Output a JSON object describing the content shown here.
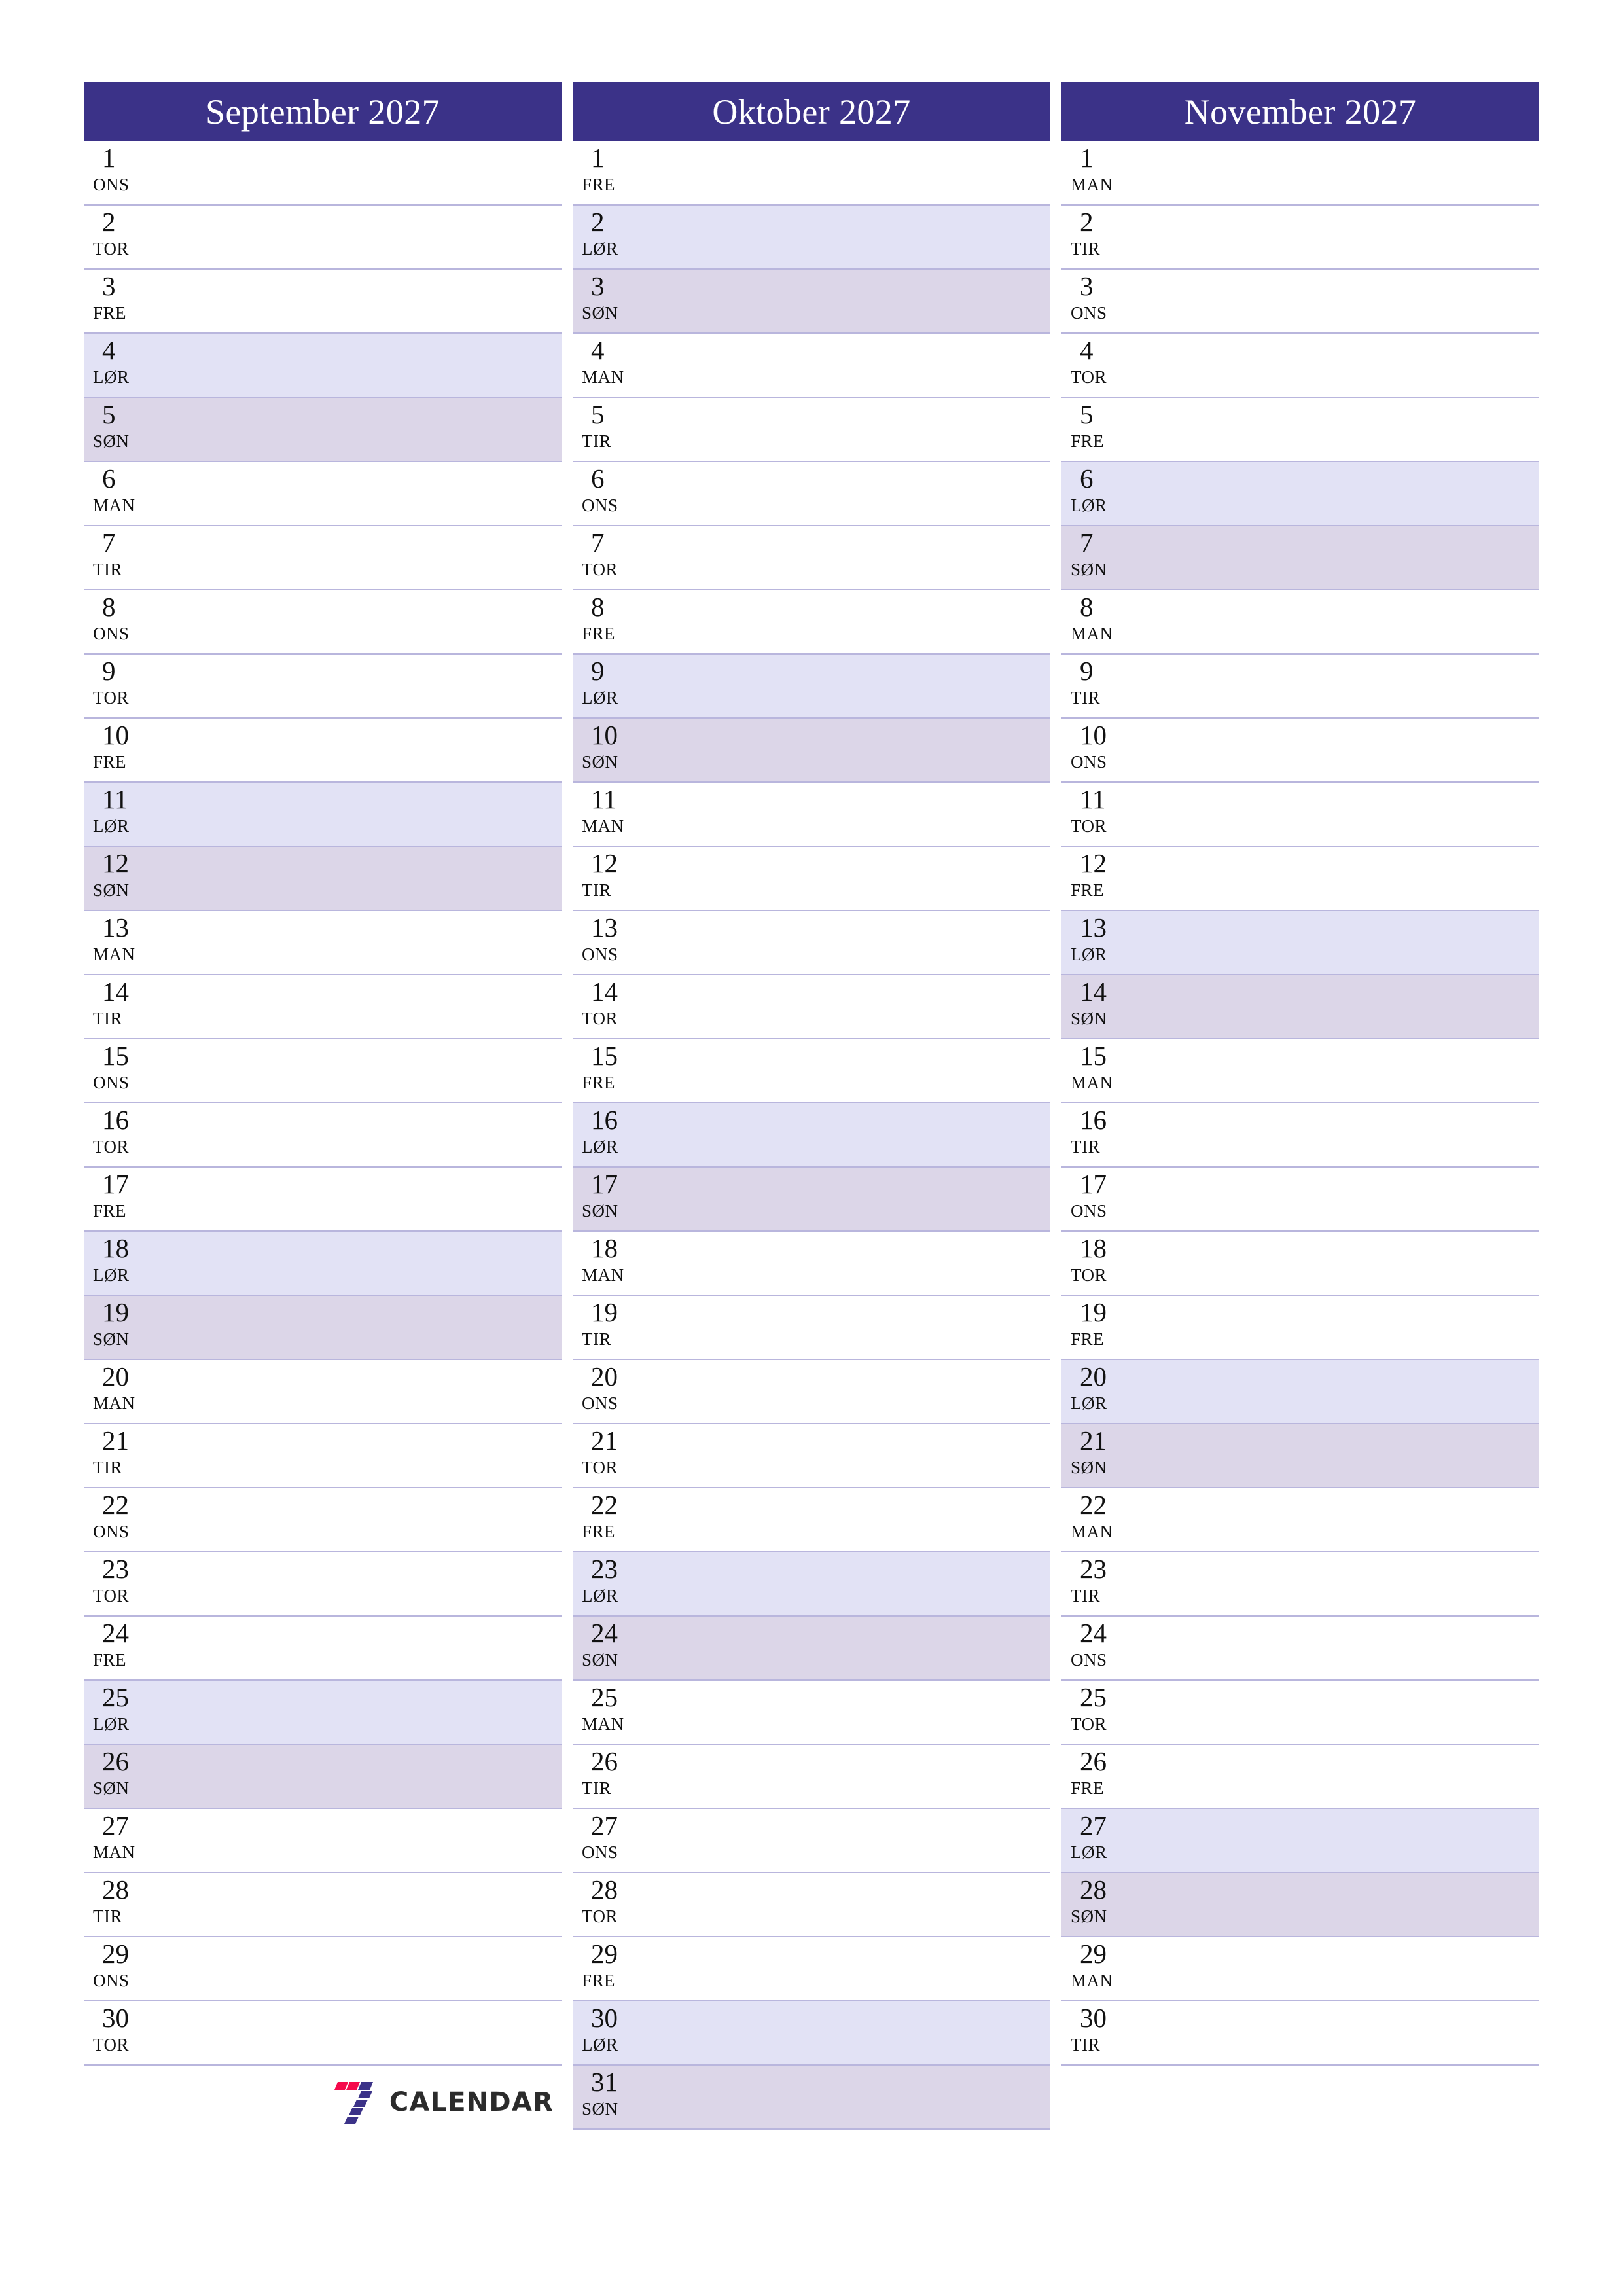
{
  "document": {
    "type": "three-month-planner",
    "year": "2027",
    "locale_language": "Norwegian",
    "page_background": "#ffffff"
  },
  "colors": {
    "header_bg": "#3B3288",
    "header_text": "#ffffff",
    "saturday_bg": "#e2e2f5",
    "sunday_bg": "#dcd6e8",
    "row_divider": "#b9b6dd",
    "day_text": "#111111",
    "logo_red": "#F5094B",
    "logo_navy": "#3B3288",
    "logo_word": "#2b2b2b"
  },
  "logo": {
    "mark_name": "seven-logo-mark",
    "word": "CALENDAR"
  },
  "months": [
    {
      "title": "September 2027",
      "days": [
        {
          "num": "1",
          "wd": "ONS",
          "kind": "weekday"
        },
        {
          "num": "2",
          "wd": "TOR",
          "kind": "weekday"
        },
        {
          "num": "3",
          "wd": "FRE",
          "kind": "weekday"
        },
        {
          "num": "4",
          "wd": "LØR",
          "kind": "sat"
        },
        {
          "num": "5",
          "wd": "SØN",
          "kind": "sun"
        },
        {
          "num": "6",
          "wd": "MAN",
          "kind": "weekday"
        },
        {
          "num": "7",
          "wd": "TIR",
          "kind": "weekday"
        },
        {
          "num": "8",
          "wd": "ONS",
          "kind": "weekday"
        },
        {
          "num": "9",
          "wd": "TOR",
          "kind": "weekday"
        },
        {
          "num": "10",
          "wd": "FRE",
          "kind": "weekday"
        },
        {
          "num": "11",
          "wd": "LØR",
          "kind": "sat"
        },
        {
          "num": "12",
          "wd": "SØN",
          "kind": "sun"
        },
        {
          "num": "13",
          "wd": "MAN",
          "kind": "weekday"
        },
        {
          "num": "14",
          "wd": "TIR",
          "kind": "weekday"
        },
        {
          "num": "15",
          "wd": "ONS",
          "kind": "weekday"
        },
        {
          "num": "16",
          "wd": "TOR",
          "kind": "weekday"
        },
        {
          "num": "17",
          "wd": "FRE",
          "kind": "weekday"
        },
        {
          "num": "18",
          "wd": "LØR",
          "kind": "sat"
        },
        {
          "num": "19",
          "wd": "SØN",
          "kind": "sun"
        },
        {
          "num": "20",
          "wd": "MAN",
          "kind": "weekday"
        },
        {
          "num": "21",
          "wd": "TIR",
          "kind": "weekday"
        },
        {
          "num": "22",
          "wd": "ONS",
          "kind": "weekday"
        },
        {
          "num": "23",
          "wd": "TOR",
          "kind": "weekday"
        },
        {
          "num": "24",
          "wd": "FRE",
          "kind": "weekday"
        },
        {
          "num": "25",
          "wd": "LØR",
          "kind": "sat"
        },
        {
          "num": "26",
          "wd": "SØN",
          "kind": "sun"
        },
        {
          "num": "27",
          "wd": "MAN",
          "kind": "weekday"
        },
        {
          "num": "28",
          "wd": "TIR",
          "kind": "weekday"
        },
        {
          "num": "29",
          "wd": "ONS",
          "kind": "weekday"
        },
        {
          "num": "30",
          "wd": "TOR",
          "kind": "weekday"
        }
      ],
      "has_logo": true
    },
    {
      "title": "Oktober 2027",
      "days": [
        {
          "num": "1",
          "wd": "FRE",
          "kind": "weekday"
        },
        {
          "num": "2",
          "wd": "LØR",
          "kind": "sat"
        },
        {
          "num": "3",
          "wd": "SØN",
          "kind": "sun"
        },
        {
          "num": "4",
          "wd": "MAN",
          "kind": "weekday"
        },
        {
          "num": "5",
          "wd": "TIR",
          "kind": "weekday"
        },
        {
          "num": "6",
          "wd": "ONS",
          "kind": "weekday"
        },
        {
          "num": "7",
          "wd": "TOR",
          "kind": "weekday"
        },
        {
          "num": "8",
          "wd": "FRE",
          "kind": "weekday"
        },
        {
          "num": "9",
          "wd": "LØR",
          "kind": "sat"
        },
        {
          "num": "10",
          "wd": "SØN",
          "kind": "sun"
        },
        {
          "num": "11",
          "wd": "MAN",
          "kind": "weekday"
        },
        {
          "num": "12",
          "wd": "TIR",
          "kind": "weekday"
        },
        {
          "num": "13",
          "wd": "ONS",
          "kind": "weekday"
        },
        {
          "num": "14",
          "wd": "TOR",
          "kind": "weekday"
        },
        {
          "num": "15",
          "wd": "FRE",
          "kind": "weekday"
        },
        {
          "num": "16",
          "wd": "LØR",
          "kind": "sat"
        },
        {
          "num": "17",
          "wd": "SØN",
          "kind": "sun"
        },
        {
          "num": "18",
          "wd": "MAN",
          "kind": "weekday"
        },
        {
          "num": "19",
          "wd": "TIR",
          "kind": "weekday"
        },
        {
          "num": "20",
          "wd": "ONS",
          "kind": "weekday"
        },
        {
          "num": "21",
          "wd": "TOR",
          "kind": "weekday"
        },
        {
          "num": "22",
          "wd": "FRE",
          "kind": "weekday"
        },
        {
          "num": "23",
          "wd": "LØR",
          "kind": "sat"
        },
        {
          "num": "24",
          "wd": "SØN",
          "kind": "sun"
        },
        {
          "num": "25",
          "wd": "MAN",
          "kind": "weekday"
        },
        {
          "num": "26",
          "wd": "TIR",
          "kind": "weekday"
        },
        {
          "num": "27",
          "wd": "ONS",
          "kind": "weekday"
        },
        {
          "num": "28",
          "wd": "TOR",
          "kind": "weekday"
        },
        {
          "num": "29",
          "wd": "FRE",
          "kind": "weekday"
        },
        {
          "num": "30",
          "wd": "LØR",
          "kind": "sat"
        },
        {
          "num": "31",
          "wd": "SØN",
          "kind": "sun"
        }
      ],
      "has_logo": false
    },
    {
      "title": "November 2027",
      "days": [
        {
          "num": "1",
          "wd": "MAN",
          "kind": "weekday"
        },
        {
          "num": "2",
          "wd": "TIR",
          "kind": "weekday"
        },
        {
          "num": "3",
          "wd": "ONS",
          "kind": "weekday"
        },
        {
          "num": "4",
          "wd": "TOR",
          "kind": "weekday"
        },
        {
          "num": "5",
          "wd": "FRE",
          "kind": "weekday"
        },
        {
          "num": "6",
          "wd": "LØR",
          "kind": "sat"
        },
        {
          "num": "7",
          "wd": "SØN",
          "kind": "sun"
        },
        {
          "num": "8",
          "wd": "MAN",
          "kind": "weekday"
        },
        {
          "num": "9",
          "wd": "TIR",
          "kind": "weekday"
        },
        {
          "num": "10",
          "wd": "ONS",
          "kind": "weekday"
        },
        {
          "num": "11",
          "wd": "TOR",
          "kind": "weekday"
        },
        {
          "num": "12",
          "wd": "FRE",
          "kind": "weekday"
        },
        {
          "num": "13",
          "wd": "LØR",
          "kind": "sat"
        },
        {
          "num": "14",
          "wd": "SØN",
          "kind": "sun"
        },
        {
          "num": "15",
          "wd": "MAN",
          "kind": "weekday"
        },
        {
          "num": "16",
          "wd": "TIR",
          "kind": "weekday"
        },
        {
          "num": "17",
          "wd": "ONS",
          "kind": "weekday"
        },
        {
          "num": "18",
          "wd": "TOR",
          "kind": "weekday"
        },
        {
          "num": "19",
          "wd": "FRE",
          "kind": "weekday"
        },
        {
          "num": "20",
          "wd": "LØR",
          "kind": "sat"
        },
        {
          "num": "21",
          "wd": "SØN",
          "kind": "sun"
        },
        {
          "num": "22",
          "wd": "MAN",
          "kind": "weekday"
        },
        {
          "num": "23",
          "wd": "TIR",
          "kind": "weekday"
        },
        {
          "num": "24",
          "wd": "ONS",
          "kind": "weekday"
        },
        {
          "num": "25",
          "wd": "TOR",
          "kind": "weekday"
        },
        {
          "num": "26",
          "wd": "FRE",
          "kind": "weekday"
        },
        {
          "num": "27",
          "wd": "LØR",
          "kind": "sat"
        },
        {
          "num": "28",
          "wd": "SØN",
          "kind": "sun"
        },
        {
          "num": "29",
          "wd": "MAN",
          "kind": "weekday"
        },
        {
          "num": "30",
          "wd": "TIR",
          "kind": "weekday"
        }
      ],
      "has_logo": false
    }
  ]
}
